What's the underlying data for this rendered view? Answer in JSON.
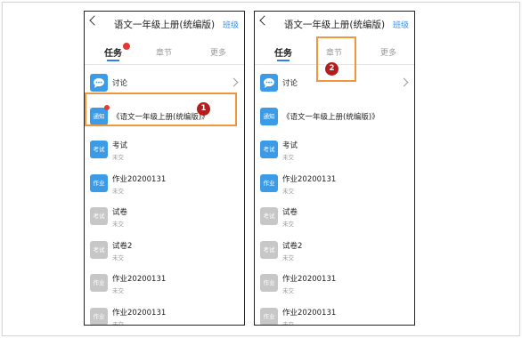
{
  "screens": [
    {
      "title": "语文一年级上册(统编版)",
      "header_right": "班级",
      "tabs": [
        "任务",
        "章节",
        "更多"
      ],
      "rows": [
        {
          "icon": "",
          "icon_name": "discussion-icon",
          "color": "blue",
          "name": "讨论",
          "sub": ""
        },
        {
          "icon": "通知",
          "icon_name": "notice-icon",
          "color": "blue",
          "name": "《语文一年级上册(统编版)》",
          "sub": ""
        },
        {
          "icon": "考试",
          "icon_name": "exam-icon",
          "color": "blue",
          "name": "考试",
          "sub": "未交"
        },
        {
          "icon": "作业",
          "icon_name": "homework-icon",
          "color": "blue",
          "name": "作业20200131",
          "sub": "未交"
        },
        {
          "icon": "考试",
          "icon_name": "exam-icon",
          "color": "gray",
          "name": "试卷",
          "sub": "未交"
        },
        {
          "icon": "考试",
          "icon_name": "exam-icon",
          "color": "gray",
          "name": "试卷2",
          "sub": "未交"
        },
        {
          "icon": "作业",
          "icon_name": "homework-icon",
          "color": "gray",
          "name": "作业20200131",
          "sub": "未交"
        },
        {
          "icon": "作业",
          "icon_name": "homework-icon",
          "color": "gray",
          "name": "作业20200131",
          "sub": "未交"
        }
      ],
      "step": "1"
    },
    {
      "title": "语文一年级上册(统编版)",
      "header_right": "班级",
      "tabs": [
        "任务",
        "章节",
        "更多"
      ],
      "rows": [
        {
          "icon": "",
          "icon_name": "discussion-icon",
          "color": "blue",
          "name": "讨论",
          "sub": ""
        },
        {
          "icon": "通知",
          "icon_name": "notice-icon",
          "color": "blue",
          "name": "《语文一年级上册(统编版)》",
          "sub": ""
        },
        {
          "icon": "考试",
          "icon_name": "exam-icon",
          "color": "blue",
          "name": "考试",
          "sub": "未交"
        },
        {
          "icon": "作业",
          "icon_name": "homework-icon",
          "color": "blue",
          "name": "作业20200131",
          "sub": "未交"
        },
        {
          "icon": "考试",
          "icon_name": "exam-icon",
          "color": "gray",
          "name": "试卷",
          "sub": "未交"
        },
        {
          "icon": "考试",
          "icon_name": "exam-icon",
          "color": "gray",
          "name": "试卷2",
          "sub": "未交"
        },
        {
          "icon": "作业",
          "icon_name": "homework-icon",
          "color": "gray",
          "name": "作业20200131",
          "sub": "未交"
        },
        {
          "icon": "作业",
          "icon_name": "homework-icon",
          "color": "gray",
          "name": "作业20200131",
          "sub": "未交"
        }
      ],
      "step": "2"
    }
  ],
  "colors": {
    "accent": "#2f80ed",
    "icon_blue": "#3c9be6",
    "icon_gray": "#c7c7c7",
    "highlight": "#f0963c",
    "step_badge": "#b71c1c"
  }
}
